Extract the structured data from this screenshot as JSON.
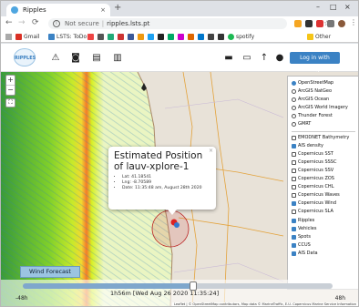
{
  "browser": {
    "tab_title": "Ripples",
    "tab_close": "×",
    "new_tab": "+",
    "controls": [
      "–",
      "□",
      "×"
    ],
    "nav": [
      "←",
      "→",
      "⟳"
    ],
    "security": "Not secure",
    "url": "ripples.lsts.pt",
    "star": "☆"
  },
  "bookmarks": {
    "items": [
      {
        "label": "Gmail",
        "color": "#d93025"
      },
      {
        "label": "LSTS: ToDo",
        "color": "#3b82c4"
      }
    ],
    "spotify": "spotify",
    "other": "Other bookmarks"
  },
  "app": {
    "logo": "RIPPLES",
    "login_label": "Log in with Google",
    "icons": [
      "warning-icon",
      "camera-icon",
      "plan-icon",
      "book-icon"
    ],
    "right_icons": [
      "ruler-icon",
      "layers-icon",
      "pin-icon",
      "marker-icon"
    ]
  },
  "map": {
    "zoom_in": "+",
    "zoom_out": "−",
    "fullscreen": "⛶",
    "base_layers": [
      {
        "label": "OpenStreetMap",
        "selected": true
      },
      {
        "label": "ArcGIS NatGeo",
        "selected": false
      },
      {
        "label": "ArcGIS Ocean",
        "selected": false
      },
      {
        "label": "ArcGIS World Imagery",
        "selected": false
      },
      {
        "label": "Thunder Forest",
        "selected": false
      },
      {
        "label": "GMRT",
        "selected": false
      }
    ],
    "overlays": [
      {
        "label": "EMODNET Bathymetry",
        "checked": false
      },
      {
        "label": "AIS density",
        "checked": true
      },
      {
        "label": "Copernicus SST",
        "checked": false
      },
      {
        "label": "Copernicus SSSC",
        "checked": false
      },
      {
        "label": "Copernicus SSV",
        "checked": false
      },
      {
        "label": "Copernicus ZOS",
        "checked": false
      },
      {
        "label": "Copernicus CHL",
        "checked": false
      },
      {
        "label": "Copernicus Waves",
        "checked": false
      },
      {
        "label": "Copernicus Wind",
        "checked": true
      },
      {
        "label": "Copernicus SLA",
        "checked": false
      },
      {
        "label": "Ripples",
        "checked": true
      },
      {
        "label": "Vehicles",
        "checked": true
      },
      {
        "label": "Spots",
        "checked": true
      },
      {
        "label": "CCUS",
        "checked": true
      },
      {
        "label": "AIS Data",
        "checked": true
      }
    ],
    "popup": {
      "title": "Estimated Position of lauv-xplore-1",
      "lines": [
        "Lat: 41.18541",
        "Lng: -8.70589",
        "Date: 11:35:48 am, August 28th 2020"
      ],
      "close": "×"
    },
    "wind_button": "Wind Forecast",
    "timeline": {
      "label": "1h56m [Wed Aug 26 2020 11:35:24]",
      "left": "-48h",
      "right": "48h",
      "progress": 0.55
    },
    "attribution": "Leaflet | © OpenStreetMap contributors, Map data © MarineTraffic, E.U. Copernicus Marine Service Information"
  }
}
